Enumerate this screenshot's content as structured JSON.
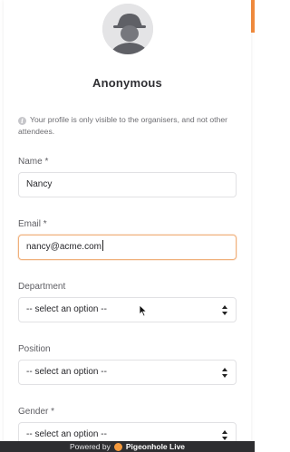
{
  "profile": {
    "name": "Anonymous",
    "info_text": "Your profile is only visible to the organisers, and not other attendees."
  },
  "form": {
    "name": {
      "label": "Name *",
      "value": "Nancy"
    },
    "email": {
      "label": "Email *",
      "value": "nancy@acme.com"
    },
    "department": {
      "label": "Department",
      "value": "-- select an option --"
    },
    "position": {
      "label": "Position",
      "value": "-- select an option --"
    },
    "gender": {
      "label": "Gender *",
      "value": "-- select an option --"
    }
  },
  "footer": {
    "prefix": "Powered by",
    "brand": "Pigeonhole Live"
  },
  "colors": {
    "accent": "#f28a3c",
    "focus_border": "#f0b17c",
    "footer_bg": "#2e2e31"
  },
  "icons": {
    "avatar": "person-silhouette-icon",
    "info": "info-icon",
    "select": "sort-arrows-icon",
    "logo": "pigeonhole-logo-icon"
  }
}
